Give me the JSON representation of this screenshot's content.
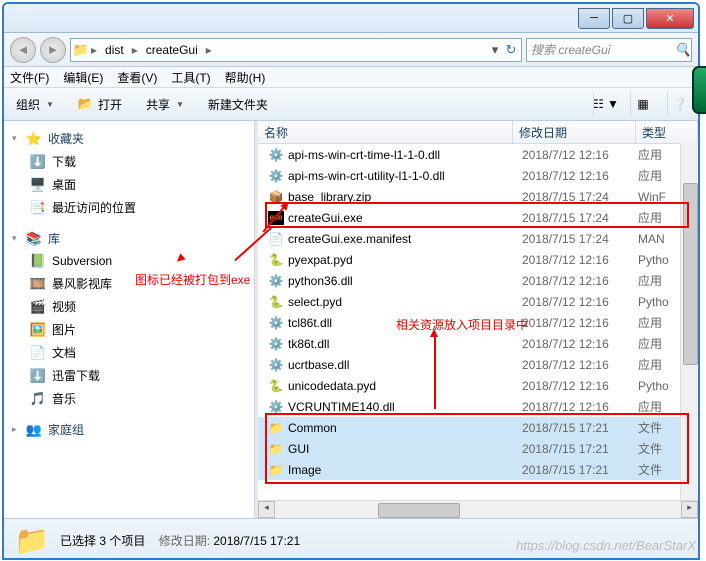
{
  "title": {
    "app": ""
  },
  "nav": {
    "back": "◄",
    "fwd": "►"
  },
  "breadcrumbs": {
    "b0": "dist",
    "b1": "createGui"
  },
  "search": {
    "placeholder": "搜索 createGui"
  },
  "menu": {
    "file": "文件(F)",
    "edit": "编辑(E)",
    "view": "查看(V)",
    "tools": "工具(T)",
    "help": "帮助(H)"
  },
  "toolbar": {
    "org": "组织",
    "open": "打开",
    "share": "共享",
    "newfolder": "新建文件夹"
  },
  "sidebar": {
    "fav": {
      "head": "收藏夹",
      "i0": "下载",
      "i1": "桌面",
      "i2": "最近访问的位置"
    },
    "lib": {
      "head": "库",
      "i0": "Subversion",
      "i1": "暴风影视库",
      "i2": "视频",
      "i3": "图片",
      "i4": "文档",
      "i5": "迅雷下载",
      "i6": "音乐"
    },
    "home": {
      "head": "家庭组"
    }
  },
  "cols": {
    "name": "名称",
    "date": "修改日期",
    "type": "类型"
  },
  "files": {
    "r0": {
      "name": "api-ms-win-crt-time-l1-1-0.dll",
      "date": "2018/7/12 12:16",
      "type": "应用"
    },
    "r1": {
      "name": "api-ms-win-crt-utility-l1-1-0.dll",
      "date": "2018/7/12 12:16",
      "type": "应用"
    },
    "r2": {
      "name": "base_library.zip",
      "date": "2018/7/15 17:24",
      "type": "WinF"
    },
    "r3": {
      "name": "createGui.exe",
      "date": "2018/7/15 17:24",
      "type": "应用"
    },
    "r4": {
      "name": "createGui.exe.manifest",
      "date": "2018/7/15 17:24",
      "type": "MAN"
    },
    "r5": {
      "name": "pyexpat.pyd",
      "date": "2018/7/12 12:16",
      "type": "Pytho"
    },
    "r6": {
      "name": "python36.dll",
      "date": "2018/7/12 12:16",
      "type": "应用"
    },
    "r7": {
      "name": "select.pyd",
      "date": "2018/7/12 12:16",
      "type": "Pytho"
    },
    "r8": {
      "name": "tcl86t.dll",
      "date": "2018/7/12 12:16",
      "type": "应用"
    },
    "r9": {
      "name": "tk86t.dll",
      "date": "2018/7/12 12:16",
      "type": "应用"
    },
    "r10": {
      "name": "ucrtbase.dll",
      "date": "2018/7/12 12:16",
      "type": "应用"
    },
    "r11": {
      "name": "unicodedata.pyd",
      "date": "2018/7/12 12:16",
      "type": "Pytho"
    },
    "r12": {
      "name": "VCRUNTIME140.dll",
      "date": "2018/7/12 12:16",
      "type": "应用"
    },
    "r13": {
      "name": "Common",
      "date": "2018/7/15 17:21",
      "type": "文件"
    },
    "r14": {
      "name": "GUI",
      "date": "2018/7/15 17:21",
      "type": "文件"
    },
    "r15": {
      "name": "Image",
      "date": "2018/7/15 17:21",
      "type": "文件"
    }
  },
  "status": {
    "text": "已选择 3 个项目",
    "label": "修改日期:",
    "date": "2018/7/15 17:21"
  },
  "annotations": {
    "a1": "图标已经被打包到exe",
    "a2": "相关资源放入项目目录中"
  },
  "watermark": "https://blog.csdn.net/BearStarX"
}
